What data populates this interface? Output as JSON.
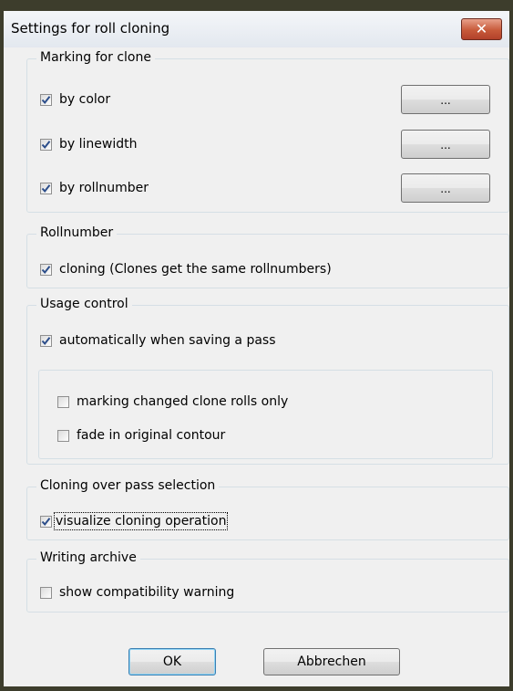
{
  "window": {
    "title": "Settings for roll cloning",
    "close_label": "✕"
  },
  "marking_group": {
    "label": "Marking for clone",
    "items": [
      {
        "label": "by color",
        "checked": true,
        "button_label": "..."
      },
      {
        "label": "by linewidth",
        "checked": true,
        "button_label": "..."
      },
      {
        "label": "by rollnumber",
        "checked": true,
        "button_label": "..."
      }
    ]
  },
  "rollnumber_group": {
    "label": "Rollnumber",
    "cloning_label": "cloning (Clones get the same rollnumbers)",
    "cloning_checked": true
  },
  "usage_group": {
    "label": "Usage control",
    "auto_label": "automatically when saving a pass",
    "auto_checked": true,
    "changed_only_label": "marking changed clone rolls only",
    "changed_only_checked": false,
    "fade_label": "fade in original contour",
    "fade_checked": false
  },
  "pass_selection_group": {
    "label": "Cloning over pass selection",
    "visualize_label": "visualize cloning operation",
    "visualize_checked": true
  },
  "archive_group": {
    "label": "Writing archive",
    "warning_label": "show compatibility warning",
    "warning_checked": false
  },
  "buttons": {
    "ok_label": "OK",
    "cancel_label": "Abbrechen"
  }
}
